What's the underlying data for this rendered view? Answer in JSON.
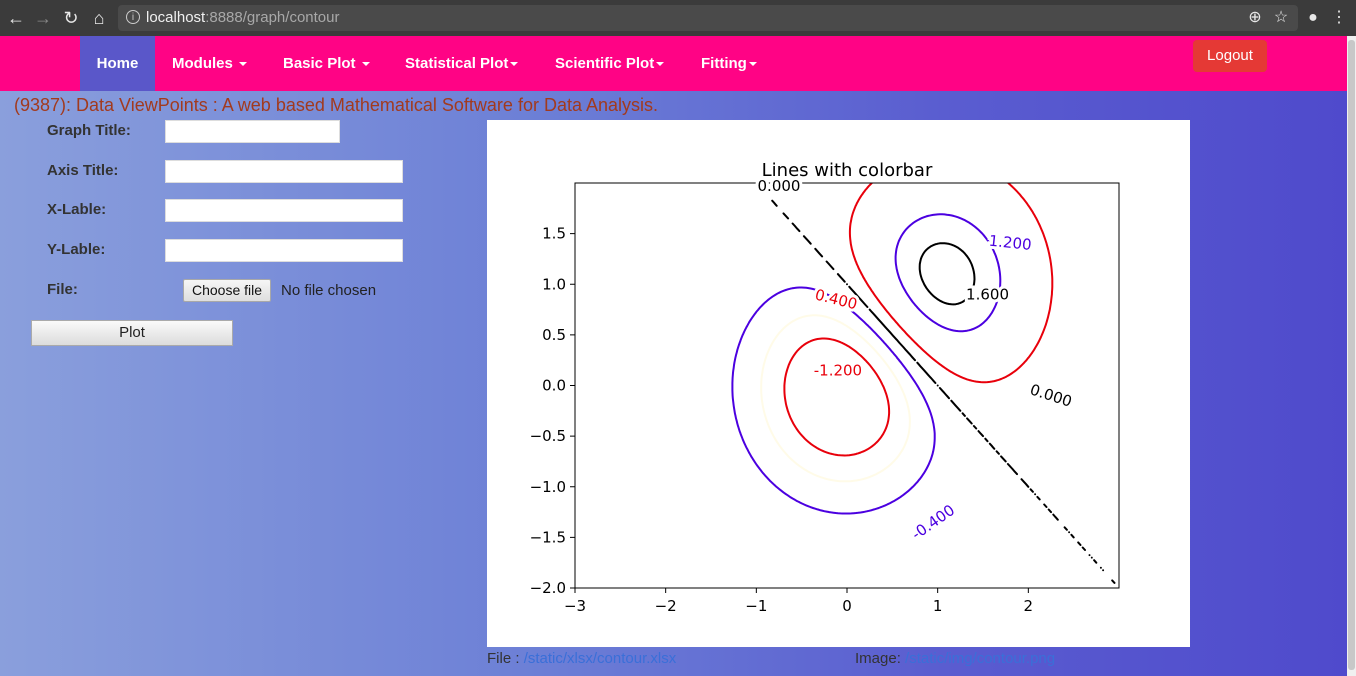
{
  "browser": {
    "url_host": "localhost",
    "url_rest": ":8888/graph/contour",
    "back_icon": "arrow-left-icon",
    "forward_icon": "arrow-right-icon",
    "reload_icon": "reload-icon",
    "home_icon": "home-icon"
  },
  "navbar": {
    "items": [
      {
        "label": "Home",
        "active": true,
        "dropdown": false
      },
      {
        "label": "Modules",
        "dropdown": true
      },
      {
        "label": "Basic Plot",
        "dropdown": true
      },
      {
        "label": "Statistical Plot",
        "dropdown": true
      },
      {
        "label": "Scientific Plot",
        "dropdown": true
      },
      {
        "label": "Fitting",
        "dropdown": true
      }
    ],
    "logout_label": "Logout",
    "colors": {
      "bar": "#ff0385",
      "active": "#5a57c9",
      "logout": "#e53935"
    }
  },
  "heading": "(9387): Data ViewPoints : A web based Mathematical Software for Data Analysis.",
  "form": {
    "graph_title_label": "Graph Title:",
    "axis_title_label": "Axis Title:",
    "x_label_label": "X-Lable:",
    "y_label_label": "Y-Lable:",
    "file_label": "File:",
    "graph_title_value": "",
    "axis_title_value": "",
    "x_label_value": "",
    "y_label_value": "",
    "choose_file_label": "Choose file",
    "no_file_text": "No file chosen",
    "plot_label": "Plot"
  },
  "chart_data": {
    "type": "contour",
    "title": "Lines with colorbar",
    "xlim": [
      -3,
      3
    ],
    "ylim": [
      -2,
      2
    ],
    "xticks": [
      "−3",
      "−2",
      "−1",
      "0",
      "1",
      "2"
    ],
    "yticks": [
      "−2.0",
      "−1.5",
      "−1.0",
      "−0.5",
      "0.0",
      "0.5",
      "1.0",
      "1.5"
    ],
    "levels": [
      {
        "value": -1.2,
        "label": "-1.200",
        "color": "#e8000b"
      },
      {
        "value": -0.8,
        "label": "",
        "color": "#fffbe8"
      },
      {
        "value": -0.4,
        "label": "-0.400",
        "color": "#4b00e0"
      },
      {
        "value": 0.0,
        "label": "0.000",
        "color": "#000000"
      },
      {
        "value": 0.4,
        "label": "0.400",
        "color": "#e8000b"
      },
      {
        "value": 1.2,
        "label": "1.200",
        "color": "#4b00e0"
      },
      {
        "value": 1.6,
        "label": "1.600",
        "color": "#000000"
      }
    ]
  },
  "links": {
    "file_prefix": "File : ",
    "file_path": "/static/xlsx/contour.xlsx",
    "image_prefix": "Image: ",
    "image_path": "/static/img/contour.png"
  }
}
